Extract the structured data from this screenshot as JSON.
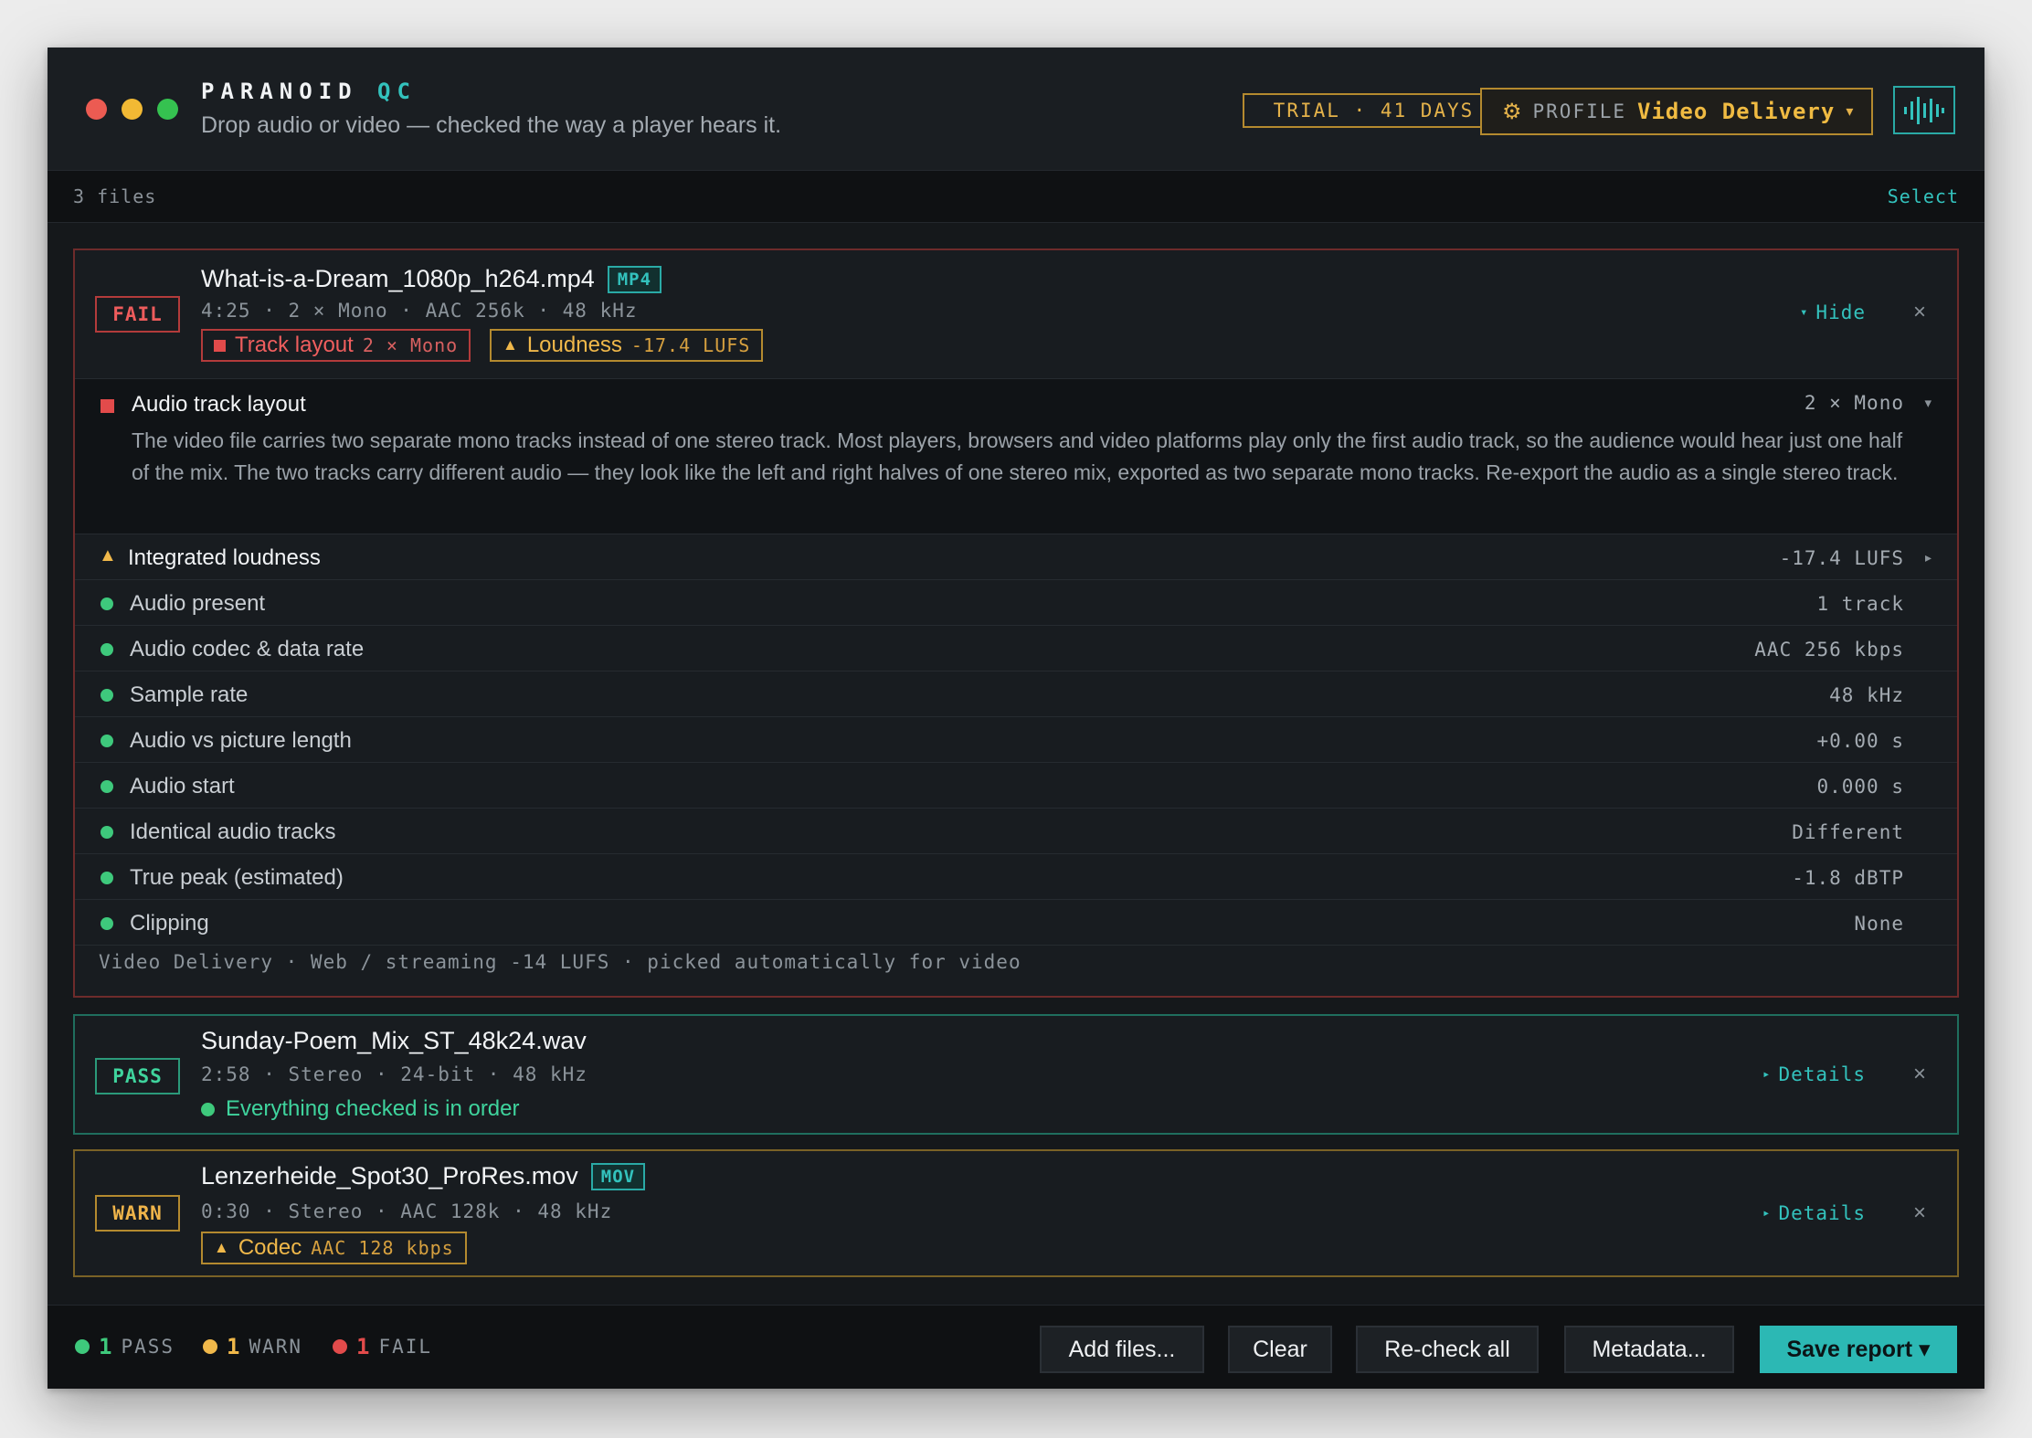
{
  "app": {
    "brand_part1": "PARANOID",
    "brand_part2": "QC",
    "tagline": "Drop audio or video — checked the way a player hears it.",
    "trial": "TRIAL · 41 DAYS",
    "profile_label": "PROFILE",
    "profile_value": "Video Delivery",
    "profile_caret": "▾",
    "gear_glyph": "⚙"
  },
  "filebar": {
    "count": "3 files",
    "select": "Select"
  },
  "files": [
    {
      "status": "FAIL",
      "name": "What-is-a-Dream_1080p_h264.mp4",
      "ext": "MP4",
      "meta": "4:25 · 2 × Mono · AAC 256k · 48 kHz",
      "chips": [
        {
          "label": "Track layout",
          "value": "2 × Mono"
        },
        {
          "label": "Loudness",
          "value": "-17.4 LUFS"
        }
      ],
      "toggle_label": "Hide",
      "toggle_glyph": "▾",
      "close": "×",
      "detail": {
        "title": "Audio track layout",
        "value": "2 × Mono",
        "caret": "▾",
        "description": "The video file carries two separate mono tracks instead of one stereo track. Most players, browsers and video platforms play only the first audio track, so the audience would hear just one half of the mix. The two tracks carry different audio — they look like the left and right halves of one stereo mix, exported as two separate mono tracks. Re-export the audio as a single stereo track."
      },
      "checks": [
        {
          "title": "Integrated loudness",
          "value": "-17.4 LUFS",
          "status": "warn",
          "arrow": "▸"
        },
        {
          "title": "Audio present",
          "value": "1 track",
          "status": "pass"
        },
        {
          "title": "Audio codec & data rate",
          "value": "AAC 256 kbps",
          "status": "pass"
        },
        {
          "title": "Sample rate",
          "value": "48 kHz",
          "status": "pass"
        },
        {
          "title": "Audio vs picture length",
          "value": "+0.00 s",
          "status": "pass"
        },
        {
          "title": "Audio start",
          "value": "0.000 s",
          "status": "pass"
        },
        {
          "title": "Identical audio tracks",
          "value": "Different",
          "status": "pass"
        },
        {
          "title": "True peak (estimated)",
          "value": "-1.8 dBTP",
          "status": "pass"
        },
        {
          "title": "Clipping",
          "value": "None",
          "status": "pass"
        }
      ],
      "footnote": "Video Delivery · Web / streaming -14 LUFS · picked automatically for video"
    },
    {
      "status": "PASS",
      "name": "Sunday-Poem_Mix_ST_48k24.wav",
      "meta": "2:58 · Stereo · 24-bit · 48 kHz",
      "ok_message": "Everything checked is in order",
      "toggle_label": "Details",
      "toggle_glyph": "▸",
      "close": "×"
    },
    {
      "status": "WARN",
      "name": "Lenzerheide_Spot30_ProRes.mov",
      "ext": "MOV",
      "meta": "0:30 · Stereo · AAC 128k · 48 kHz",
      "chips": [
        {
          "label": "Codec",
          "value": "AAC 128 kbps"
        }
      ],
      "toggle_label": "Details",
      "toggle_glyph": "▸",
      "close": "×"
    }
  ],
  "footer": {
    "stats": [
      {
        "count": "1",
        "label": "PASS",
        "color": "#3ec97c"
      },
      {
        "count": "1",
        "label": "WARN",
        "color": "#f0b84a"
      },
      {
        "count": "1",
        "label": "FAIL",
        "color": "#e24b4b"
      }
    ],
    "buttons": {
      "add": "Add files...",
      "clear": "Clear",
      "recheck": "Re-check all",
      "metadata": "Metadata...",
      "save": "Save report ▾"
    }
  },
  "colors": {
    "accent": "#33c2bd",
    "pass": "#3ec97c",
    "warn": "#f0b84a",
    "fail": "#e24b4b"
  },
  "icons": {
    "brand_button": "waveform-icon",
    "warn": "warning-triangle-icon",
    "fail": "error-square-icon",
    "pass": "check-dot-icon"
  }
}
